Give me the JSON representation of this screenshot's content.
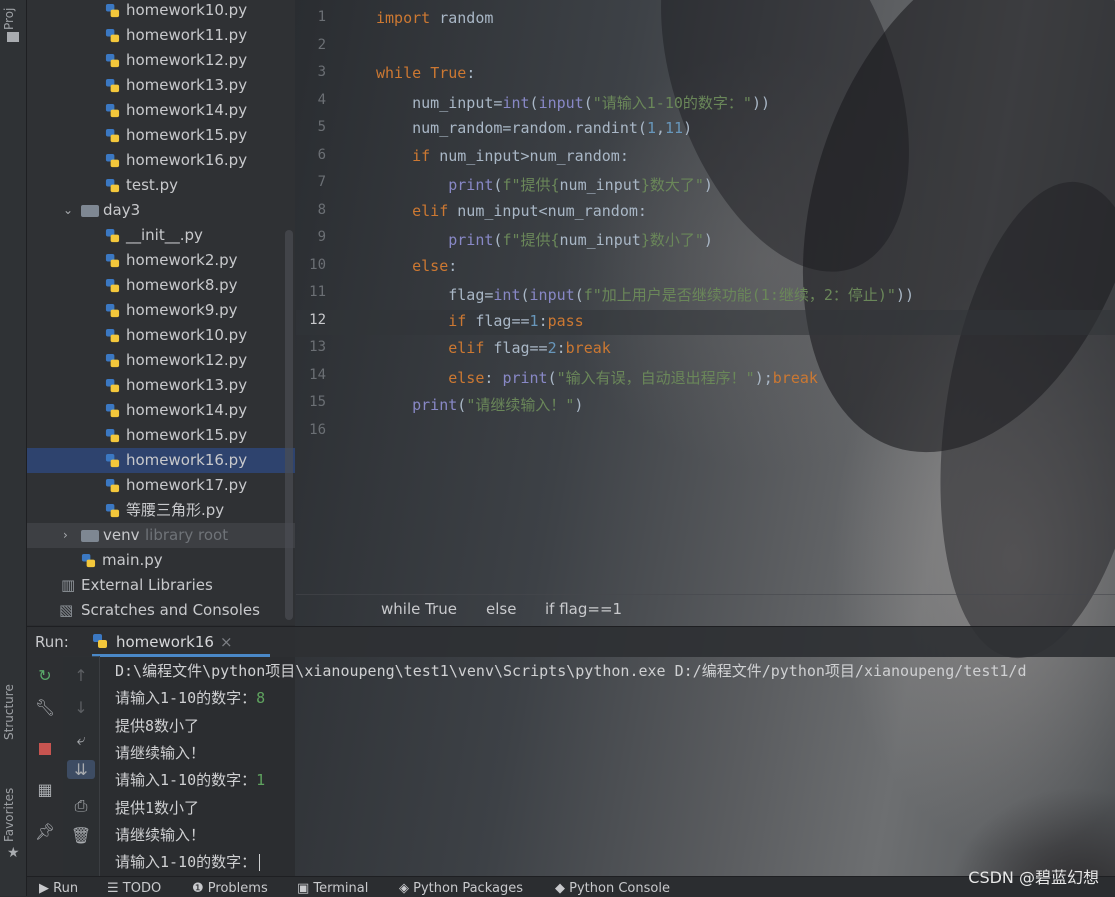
{
  "left_strip": {
    "project_tab": "Proj",
    "structure_tab": "Structure",
    "favorites_tab": "Favorites"
  },
  "project_tree": [
    {
      "label": "homework10.py",
      "type": "py",
      "indent": 2
    },
    {
      "label": "homework11.py",
      "type": "py",
      "indent": 2
    },
    {
      "label": "homework12.py",
      "type": "py",
      "indent": 2
    },
    {
      "label": "homework13.py",
      "type": "py",
      "indent": 2
    },
    {
      "label": "homework14.py",
      "type": "py",
      "indent": 2
    },
    {
      "label": "homework15.py",
      "type": "py",
      "indent": 2
    },
    {
      "label": "homework16.py",
      "type": "py",
      "indent": 2
    },
    {
      "label": "test.py",
      "type": "py",
      "indent": 2
    },
    {
      "label": "day3",
      "type": "folder-open",
      "indent": 1
    },
    {
      "label": "__init__.py",
      "type": "py",
      "indent": 2
    },
    {
      "label": "homework2.py",
      "type": "py",
      "indent": 2
    },
    {
      "label": "homework8.py",
      "type": "py",
      "indent": 2
    },
    {
      "label": "homework9.py",
      "type": "py",
      "indent": 2
    },
    {
      "label": "homework10.py",
      "type": "py",
      "indent": 2
    },
    {
      "label": "homework12.py",
      "type": "py",
      "indent": 2
    },
    {
      "label": "homework13.py",
      "type": "py",
      "indent": 2
    },
    {
      "label": "homework14.py",
      "type": "py",
      "indent": 2
    },
    {
      "label": "homework15.py",
      "type": "py",
      "indent": 2
    },
    {
      "label": "homework16.py",
      "type": "py",
      "indent": 2,
      "selected": true
    },
    {
      "label": "homework17.py",
      "type": "py",
      "indent": 2
    },
    {
      "label": "等腰三角形.py",
      "type": "py",
      "indent": 2
    },
    {
      "label": "venv",
      "type": "folder-closed",
      "indent": 1,
      "suffix": "library root"
    },
    {
      "label": "main.py",
      "type": "py",
      "indent": 1
    },
    {
      "label": "External Libraries",
      "type": "libs",
      "indent": 0
    },
    {
      "label": "Scratches and Consoles",
      "type": "scratch",
      "indent": 0
    }
  ],
  "editor": {
    "line_numbers": [
      "1",
      "2",
      "3",
      "4",
      "5",
      "6",
      "7",
      "8",
      "9",
      "10",
      "11",
      "12",
      "13",
      "14",
      "15",
      "16"
    ],
    "current_line": "12",
    "code_lines": [
      [
        {
          "t": "import",
          "c": "kw"
        },
        {
          "t": " random",
          "c": ""
        }
      ],
      [],
      [
        {
          "t": "while",
          "c": "kw"
        },
        {
          "t": " ",
          "c": ""
        },
        {
          "t": "True",
          "c": "kw"
        },
        {
          "t": ":",
          "c": ""
        }
      ],
      [
        {
          "t": "    num_input=",
          "c": ""
        },
        {
          "t": "int",
          "c": "fn"
        },
        {
          "t": "(",
          "c": ""
        },
        {
          "t": "input",
          "c": "fn"
        },
        {
          "t": "(",
          "c": ""
        },
        {
          "t": "\"请输入1-10的数字：\"",
          "c": "str"
        },
        {
          "t": "))",
          "c": ""
        }
      ],
      [
        {
          "t": "    num_random=random.randint(",
          "c": ""
        },
        {
          "t": "1",
          "c": "num"
        },
        {
          "t": ",",
          "c": ""
        },
        {
          "t": "11",
          "c": "num"
        },
        {
          "t": ")",
          "c": ""
        }
      ],
      [
        {
          "t": "    ",
          "c": ""
        },
        {
          "t": "if",
          "c": "kw"
        },
        {
          "t": " num_input>num_random:",
          "c": ""
        }
      ],
      [
        {
          "t": "        ",
          "c": ""
        },
        {
          "t": "print",
          "c": "fn"
        },
        {
          "t": "(",
          "c": ""
        },
        {
          "t": "f\"提供{",
          "c": "str"
        },
        {
          "t": "num_input",
          "c": ""
        },
        {
          "t": "}数大了\"",
          "c": "str"
        },
        {
          "t": ")",
          "c": ""
        }
      ],
      [
        {
          "t": "    ",
          "c": ""
        },
        {
          "t": "elif",
          "c": "kw"
        },
        {
          "t": " num_input<num_random:",
          "c": ""
        }
      ],
      [
        {
          "t": "        ",
          "c": ""
        },
        {
          "t": "print",
          "c": "fn"
        },
        {
          "t": "(",
          "c": ""
        },
        {
          "t": "f\"提供{",
          "c": "str"
        },
        {
          "t": "num_input",
          "c": ""
        },
        {
          "t": "}数小了\"",
          "c": "str"
        },
        {
          "t": ")",
          "c": ""
        }
      ],
      [
        {
          "t": "    ",
          "c": ""
        },
        {
          "t": "else",
          "c": "kw"
        },
        {
          "t": ":",
          "c": ""
        }
      ],
      [
        {
          "t": "        flag=",
          "c": ""
        },
        {
          "t": "int",
          "c": "fn"
        },
        {
          "t": "(",
          "c": ""
        },
        {
          "t": "input",
          "c": "fn"
        },
        {
          "t": "(",
          "c": ""
        },
        {
          "t": "f\"加上用户是否继续功能(1:继续，2：停止)\"",
          "c": "str"
        },
        {
          "t": "))",
          "c": ""
        }
      ],
      [
        {
          "t": "        ",
          "c": ""
        },
        {
          "t": "if",
          "c": "kw"
        },
        {
          "t": " flag==",
          "c": ""
        },
        {
          "t": "1",
          "c": "num"
        },
        {
          "t": ":",
          "c": ""
        },
        {
          "t": "pass",
          "c": "kw"
        }
      ],
      [
        {
          "t": "        ",
          "c": ""
        },
        {
          "t": "elif",
          "c": "kw"
        },
        {
          "t": " flag==",
          "c": ""
        },
        {
          "t": "2",
          "c": "num"
        },
        {
          "t": ":",
          "c": ""
        },
        {
          "t": "break",
          "c": "kw"
        }
      ],
      [
        {
          "t": "        ",
          "c": ""
        },
        {
          "t": "else",
          "c": "kw"
        },
        {
          "t": ": ",
          "c": ""
        },
        {
          "t": "print",
          "c": "fn"
        },
        {
          "t": "(",
          "c": ""
        },
        {
          "t": "\"输入有误，自动退出程序！\"",
          "c": "str"
        },
        {
          "t": ");",
          "c": ""
        },
        {
          "t": "break",
          "c": "kw"
        }
      ],
      [
        {
          "t": "    ",
          "c": ""
        },
        {
          "t": "print",
          "c": "fn"
        },
        {
          "t": "(",
          "c": ""
        },
        {
          "t": "\"请继续输入！\"",
          "c": "str"
        },
        {
          "t": ")",
          "c": ""
        }
      ],
      []
    ]
  },
  "breadcrumbs": [
    "while True",
    "else",
    "if flag==1"
  ],
  "run": {
    "label": "Run:",
    "tab_name": "homework16",
    "tab_close": "×",
    "console_lines": [
      {
        "text": "D:\\编程文件\\python项目\\xianoupeng\\test1\\venv\\Scripts\\python.exe D:/编程文件/python项目/xianoupeng/test1/d",
        "input": ""
      },
      {
        "text": "请输入1-10的数字：",
        "input": "8"
      },
      {
        "text": "提供8数小了",
        "input": ""
      },
      {
        "text": "请继续输入！",
        "input": ""
      },
      {
        "text": "请输入1-10的数字：",
        "input": "1"
      },
      {
        "text": "提供1数小了",
        "input": ""
      },
      {
        "text": "请继续输入！",
        "input": ""
      },
      {
        "text": "请输入1-10的数字：",
        "input": "",
        "cursor": true
      }
    ]
  },
  "bottom_bar": {
    "items": [
      "Run",
      "TODO",
      "Problems",
      "Terminal",
      "Python Packages",
      "Python Console"
    ],
    "watermark": "CSDN @碧蓝幻想"
  },
  "colors": {
    "keyword": "#cc7832",
    "string": "#6a8759",
    "number": "#6897bb",
    "builtin": "#8888c6",
    "selection": "#2e436e",
    "accent": "#4a88c7"
  }
}
